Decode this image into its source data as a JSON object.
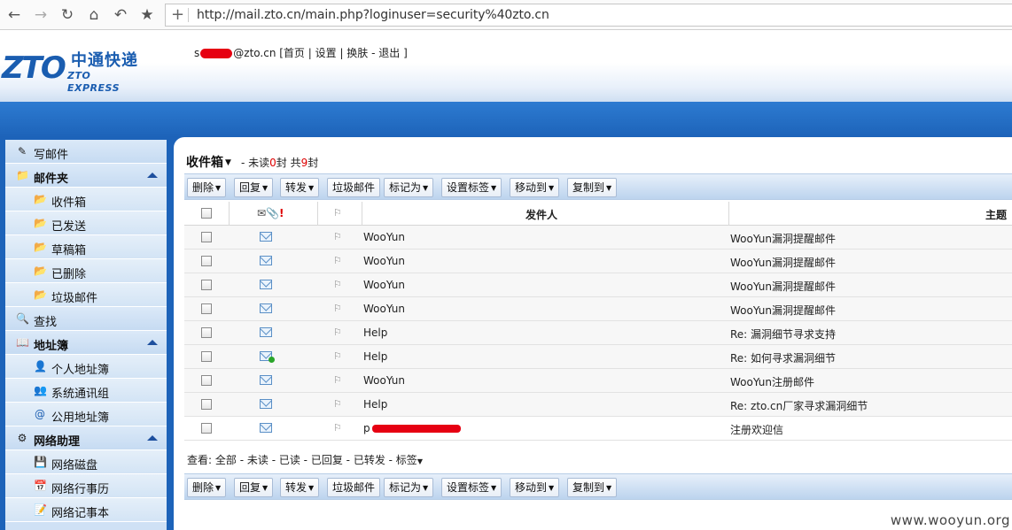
{
  "browser": {
    "url": "http://mail.zto.cn/main.php?loginuser=security%40zto.cn",
    "icons": [
      "back-icon",
      "forward-icon",
      "reload-icon",
      "home-icon",
      "history-icon",
      "star-icon",
      "new-tab-icon"
    ]
  },
  "header": {
    "logo_en": "ZTO",
    "logo_cn": "中通快递",
    "logo_sub": "ZTO EXPRESS",
    "user_prefix": "s",
    "user_suffix": "@zto.cn",
    "links": [
      "首页",
      "设置",
      "换肤",
      "退出"
    ]
  },
  "sidebar": {
    "compose": "写邮件",
    "folders_group": "邮件夹",
    "folders": [
      "收件箱",
      "已发送",
      "草稿箱",
      "已删除",
      "垃圾邮件"
    ],
    "search": "查找",
    "address_group": "地址簿",
    "address": [
      "个人地址簿",
      "系统通讯组",
      "公用地址簿"
    ],
    "net_group": "网络助理",
    "net": [
      "网络磁盘",
      "网络行事历",
      "网络记事本"
    ]
  },
  "folder": {
    "title": "收件箱",
    "info_prefix": "- 未读",
    "unread": "0",
    "info_mid": "封 共",
    "total": "9",
    "info_suffix": "封"
  },
  "toolbar": {
    "buttons": [
      "删除",
      "回复",
      "转发",
      "垃圾邮件",
      "标记为",
      "设置标签",
      "移动到",
      "复制到"
    ]
  },
  "table": {
    "col_sender": "发件人",
    "col_subject": "主题",
    "rows": [
      {
        "sender": "WooYun",
        "subject": "WooYun漏洞提醒邮件"
      },
      {
        "sender": "WooYun",
        "subject": "WooYun漏洞提醒邮件"
      },
      {
        "sender": "WooYun",
        "subject": "WooYun漏洞提醒邮件"
      },
      {
        "sender": "WooYun",
        "subject": "WooYun漏洞提醒邮件"
      },
      {
        "sender": "Help",
        "subject": "Re: 漏洞细节寻求支持"
      },
      {
        "sender": "Help",
        "subject": "Re: 如何寻求漏洞细节"
      },
      {
        "sender": "WooYun",
        "subject": "WooYun注册邮件"
      },
      {
        "sender": "Help",
        "subject": "Re: zto.cn厂家寻求漏洞细节"
      },
      {
        "sender": "p",
        "subject": "注册欢迎信"
      }
    ]
  },
  "view": {
    "label": "查看:",
    "options": [
      "全部",
      "未读",
      "已读",
      "已回复",
      "已转发",
      "标签"
    ]
  },
  "watermark": "www.wooyun.org"
}
